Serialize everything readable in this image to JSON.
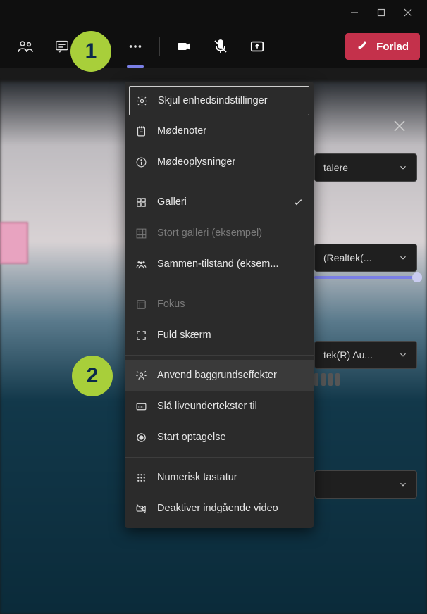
{
  "window_controls": {
    "minimize": "minimize",
    "maximize": "maximize",
    "close": "close"
  },
  "toolbar": {
    "people": "people",
    "chat": "chat",
    "unknown": "",
    "more": "more",
    "camera": "camera",
    "mic": "mic",
    "share": "share",
    "leave_label": "Forlad"
  },
  "menu": {
    "device_settings": "Skjul enhedsindstillinger",
    "notes": "Mødenoter",
    "info": "Mødeoplysninger",
    "gallery": "Galleri",
    "large_gallery": "Stort galleri (eksempel)",
    "together": "Sammen-tilstand (eksem...",
    "focus": "Fokus",
    "fullscreen": "Fuld skærm",
    "bg_effects": "Anvend baggrundseffekter",
    "captions": "Slå liveundertekster til",
    "record": "Start optagelse",
    "keypad": "Numerisk tastatur",
    "disable_video": "Deaktiver indgående video"
  },
  "right": {
    "speakers": "talere",
    "mic": "(Realtek(...",
    "audio": "tek(R) Au..."
  },
  "callouts": {
    "one": "1",
    "two": "2"
  }
}
